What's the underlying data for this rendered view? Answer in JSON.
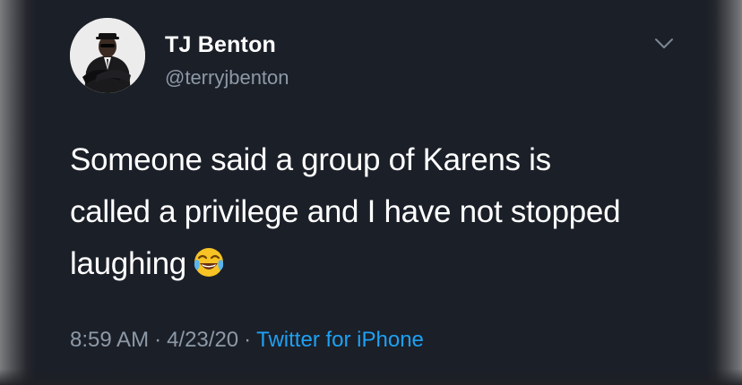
{
  "tweet": {
    "author": {
      "display_name": "TJ Benton",
      "handle": "@terryjbenton"
    },
    "text_lines": [
      "Someone said a group of Karens is",
      "called a privilege and I have not stopped",
      "laughing"
    ],
    "emoji": "face-with-tears-of-joy",
    "meta": {
      "time": "8:59 AM",
      "separator": "·",
      "date": "4/23/20",
      "source": "Twitter for iPhone"
    },
    "menu_icon": "chevron-down-icon"
  },
  "colors": {
    "background": "#1b1f28",
    "text_primary": "#ffffff",
    "text_secondary": "#8d99a6",
    "link": "#1da1f2"
  }
}
